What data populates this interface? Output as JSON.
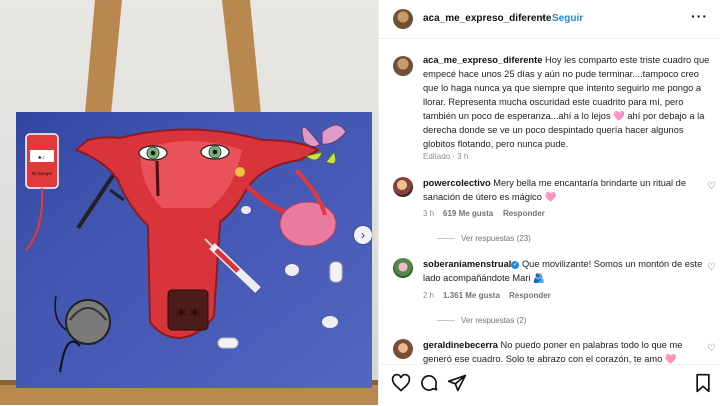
{
  "post": {
    "author": "aca_me_expreso_diferente",
    "separator": "•",
    "follow_label": "Seguir",
    "more_label": "···",
    "caption_user": "aca_me_expreso_diferente",
    "caption_text": " Hoy les comparto este triste cuadro que empecé hace unos 25 días y aún no pude terminar....tampoco creo que lo haga nunca ya que siempre que intento seguirlo me pongo a llorar. Representa mucha oscuridad este cuadrito para mí, pero también un poco de esperanza...ahí a lo lejos 🩷 ahí por debajo a la derecha donde se ve un poco despintado quería hacer algunos globitos flotando, pero nunca pude.",
    "caption_meta": "Editado · 3 h"
  },
  "painting": {
    "blood_bag_label": "Mi Sangre"
  },
  "comments": [
    {
      "user": "powercolectivo",
      "text": " Mery bella me encantaría brindarte un ritual de sanación de útero es mágico 🩷",
      "time": "3 h",
      "likes": "619 Me gusta",
      "reply": "Responder",
      "replies": "Ver respuestas (23)"
    },
    {
      "user": "soberaniamenstrual",
      "text": " Que movilizante! Somos un montón de este lado acompañándote Mari 🫂",
      "time": "2 h",
      "likes": "1.361 Me gusta",
      "reply": "Responder",
      "replies": "Ver respuestas (2)"
    },
    {
      "user": "geraldinebecerra",
      "text": " No puedo poner en palabras todo lo que me generó ese cuadro. Solo te abrazo con el corazón, te amo 🩷"
    }
  ],
  "icons": {
    "like": "heart-icon",
    "comment": "comment-icon",
    "share": "share-icon",
    "save": "bookmark-icon",
    "next": "chevron-right-icon"
  },
  "colors": {
    "link": "#1a8ae6",
    "canvas_blue": "#3c4fa8",
    "uterus_red": "#d9343c"
  }
}
